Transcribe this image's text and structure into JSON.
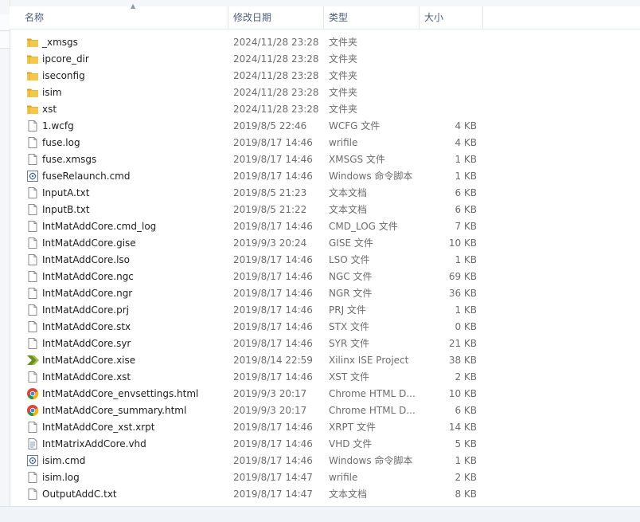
{
  "columns": {
    "name": "名称",
    "date": "修改日期",
    "type": "类型",
    "size": "大小"
  },
  "files": [
    {
      "name": "_xmsgs",
      "date": "2024/11/28 23:28",
      "type": "文件夹",
      "size": "",
      "icon": "folder-icon"
    },
    {
      "name": "ipcore_dir",
      "date": "2024/11/28 23:28",
      "type": "文件夹",
      "size": "",
      "icon": "folder-icon"
    },
    {
      "name": "iseconfig",
      "date": "2024/11/28 23:28",
      "type": "文件夹",
      "size": "",
      "icon": "folder-icon"
    },
    {
      "name": "isim",
      "date": "2024/11/28 23:28",
      "type": "文件夹",
      "size": "",
      "icon": "folder-icon"
    },
    {
      "name": "xst",
      "date": "2024/11/28 23:28",
      "type": "文件夹",
      "size": "",
      "icon": "folder-icon"
    },
    {
      "name": "1.wcfg",
      "date": "2019/8/5 22:46",
      "type": "WCFG 文件",
      "size": "4 KB",
      "icon": "file-icon"
    },
    {
      "name": "fuse.log",
      "date": "2019/8/17 14:46",
      "type": "wrifile",
      "size": "4 KB",
      "icon": "file-icon"
    },
    {
      "name": "fuse.xmsgs",
      "date": "2019/8/17 14:46",
      "type": "XMSGS 文件",
      "size": "1 KB",
      "icon": "file-icon"
    },
    {
      "name": "fuseRelaunch.cmd",
      "date": "2019/8/17 14:46",
      "type": "Windows 命令脚本",
      "size": "1 KB",
      "icon": "script-icon"
    },
    {
      "name": "InputA.txt",
      "date": "2019/8/5 21:23",
      "type": "文本文档",
      "size": "6 KB",
      "icon": "file-icon"
    },
    {
      "name": "InputB.txt",
      "date": "2019/8/5 21:22",
      "type": "文本文档",
      "size": "6 KB",
      "icon": "file-icon"
    },
    {
      "name": "IntMatAddCore.cmd_log",
      "date": "2019/8/17 14:46",
      "type": "CMD_LOG 文件",
      "size": "7 KB",
      "icon": "file-icon"
    },
    {
      "name": "IntMatAddCore.gise",
      "date": "2019/9/3 20:24",
      "type": "GISE 文件",
      "size": "10 KB",
      "icon": "file-icon"
    },
    {
      "name": "IntMatAddCore.lso",
      "date": "2019/8/17 14:46",
      "type": "LSO 文件",
      "size": "1 KB",
      "icon": "file-icon"
    },
    {
      "name": "IntMatAddCore.ngc",
      "date": "2019/8/17 14:46",
      "type": "NGC 文件",
      "size": "69 KB",
      "icon": "file-icon"
    },
    {
      "name": "IntMatAddCore.ngr",
      "date": "2019/8/17 14:46",
      "type": "NGR 文件",
      "size": "36 KB",
      "icon": "file-icon"
    },
    {
      "name": "IntMatAddCore.prj",
      "date": "2019/8/17 14:46",
      "type": "PRJ 文件",
      "size": "1 KB",
      "icon": "file-icon"
    },
    {
      "name": "IntMatAddCore.stx",
      "date": "2019/8/17 14:46",
      "type": "STX 文件",
      "size": "0 KB",
      "icon": "file-icon"
    },
    {
      "name": "IntMatAddCore.syr",
      "date": "2019/8/17 14:46",
      "type": "SYR 文件",
      "size": "21 KB",
      "icon": "file-icon"
    },
    {
      "name": "IntMatAddCore.xise",
      "date": "2019/8/14 22:59",
      "type": "Xilinx ISE Project",
      "size": "38 KB",
      "icon": "xilinx-icon"
    },
    {
      "name": "IntMatAddCore.xst",
      "date": "2019/8/17 14:46",
      "type": "XST 文件",
      "size": "2 KB",
      "icon": "file-icon"
    },
    {
      "name": "IntMatAddCore_envsettings.html",
      "date": "2019/9/3 20:17",
      "type": "Chrome HTML D...",
      "size": "10 KB",
      "icon": "chrome-icon"
    },
    {
      "name": "IntMatAddCore_summary.html",
      "date": "2019/9/3 20:17",
      "type": "Chrome HTML D...",
      "size": "6 KB",
      "icon": "chrome-icon"
    },
    {
      "name": "IntMatAddCore_xst.xrpt",
      "date": "2019/8/17 14:46",
      "type": "XRPT 文件",
      "size": "14 KB",
      "icon": "file-icon"
    },
    {
      "name": "IntMatrixAddCore.vhd",
      "date": "2019/8/17 14:46",
      "type": "VHD 文件",
      "size": "5 KB",
      "icon": "text-file-icon"
    },
    {
      "name": "isim.cmd",
      "date": "2019/8/17 14:46",
      "type": "Windows 命令脚本",
      "size": "1 KB",
      "icon": "script-icon"
    },
    {
      "name": "isim.log",
      "date": "2019/8/17 14:47",
      "type": "wrifile",
      "size": "2 KB",
      "icon": "file-icon"
    },
    {
      "name": "OutputAddC.txt",
      "date": "2019/8/17 14:47",
      "type": "文本文档",
      "size": "8 KB",
      "icon": "file-icon"
    }
  ],
  "colors": {
    "folder": "#e8b83a",
    "header_text": "#4b5d78",
    "secondary_text": "#6d6d6d"
  }
}
